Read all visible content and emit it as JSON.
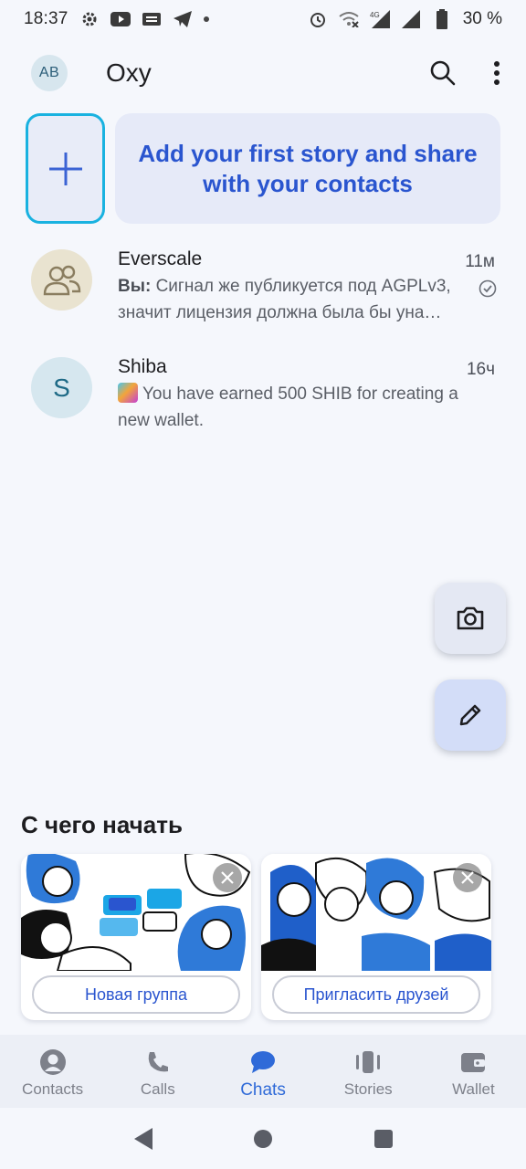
{
  "status_bar": {
    "time": "18:37",
    "battery": "30 %",
    "network": "4G"
  },
  "header": {
    "avatar_initials": "AB",
    "title": "Oxy"
  },
  "stories": {
    "banner_text": "Add your first story and share with your contacts"
  },
  "chats": [
    {
      "name": "Everscale",
      "time": "11м",
      "sender": "Вы:",
      "preview_line1": "Сигнал же публикуется под AGPLv3,",
      "preview_line2": "значит лицензия должна была бы уна…"
    },
    {
      "name": "Shiba",
      "initial": "S",
      "time": "16ч",
      "preview": "You have earned 500 SHIB for creating a new wallet."
    }
  ],
  "get_started": {
    "title": "С чего начать",
    "cards": [
      {
        "button": "Новая группа"
      },
      {
        "button": "Пригласить друзей"
      }
    ]
  },
  "nav": {
    "items": [
      {
        "label": "Contacts",
        "icon": "contacts-icon"
      },
      {
        "label": "Calls",
        "icon": "phone-icon"
      },
      {
        "label": "Chats",
        "icon": "chat-bubble-icon",
        "active": true
      },
      {
        "label": "Stories",
        "icon": "stories-icon"
      },
      {
        "label": "Wallet",
        "icon": "wallet-icon"
      }
    ]
  },
  "colors": {
    "accent": "#2f6ad8",
    "story_border": "#19b2e0",
    "banner_text": "#2a55cf",
    "background": "#f5f7fc"
  }
}
